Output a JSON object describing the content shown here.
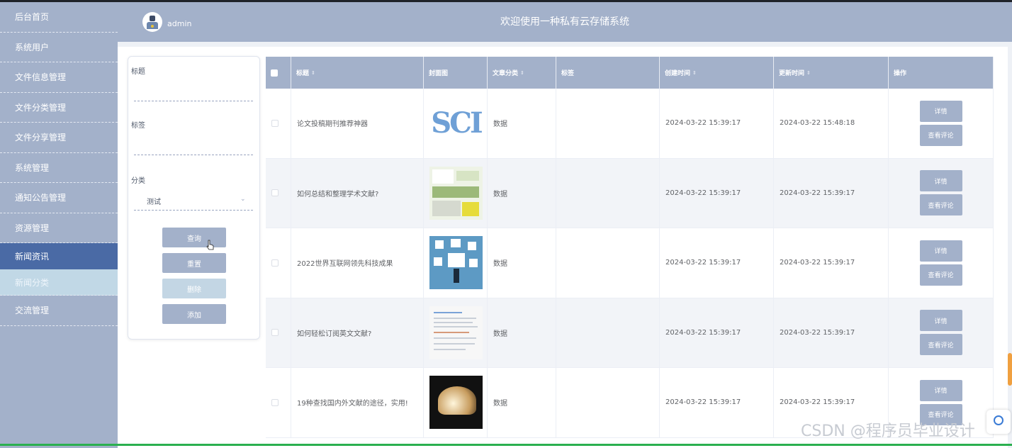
{
  "header": {
    "username": "admin",
    "title": "欢迎使用一种私有云存储系统"
  },
  "sidebar": {
    "items": [
      {
        "label": "后台首页"
      },
      {
        "label": "系统用户"
      },
      {
        "label": "文件信息管理"
      },
      {
        "label": "文件分类管理"
      },
      {
        "label": "文件分享管理"
      },
      {
        "label": "系统管理"
      },
      {
        "label": "通知公告管理"
      },
      {
        "label": "资源管理"
      },
      {
        "label": "新闻资讯",
        "active": true
      },
      {
        "label": "新闻分类",
        "sub": true
      },
      {
        "label": "交流管理"
      }
    ]
  },
  "filter": {
    "title_label": "标题",
    "tag_label": "标签",
    "category_label": "分类",
    "category_value": "测试",
    "buttons": {
      "query": "查询",
      "reset": "重置",
      "delete": "删除",
      "add": "添加"
    }
  },
  "table": {
    "columns": [
      "标题",
      "封面图",
      "文章分类",
      "标签",
      "创建时间",
      "更新时间",
      "操作"
    ],
    "rows": [
      {
        "title": "论文投稿期刊推荐神器",
        "cover": "sci",
        "category": "数据",
        "tag": "",
        "created": "2024-03-22 15:39:17",
        "updated": "2024-03-22 15:48:18"
      },
      {
        "title": "如何总结和整理学术文献?",
        "cover": "doc",
        "category": "数据",
        "tag": "",
        "created": "2024-03-22 15:39:17",
        "updated": "2024-03-22 15:39:17"
      },
      {
        "title": "2022世界互联网领先科技成果",
        "cover": "tech",
        "category": "数据",
        "tag": "",
        "created": "2024-03-22 15:39:17",
        "updated": "2024-03-22 15:39:17"
      },
      {
        "title": "如何轻松订阅英文文献?",
        "cover": "page",
        "category": "数据",
        "tag": "",
        "created": "2024-03-22 15:39:17",
        "updated": "2024-03-22 15:39:17"
      },
      {
        "title": "19种查找国内外文献的途径，实用!",
        "cover": "lamp",
        "category": "数据",
        "tag": "",
        "created": "2024-03-22 15:39:17",
        "updated": "2024-03-22 15:39:17"
      }
    ],
    "ops": {
      "detail": "详情",
      "comments": "查看评论"
    }
  },
  "cover_texts": {
    "sci": "SCI"
  },
  "watermark": "CSDN @程序员毕业设计"
}
